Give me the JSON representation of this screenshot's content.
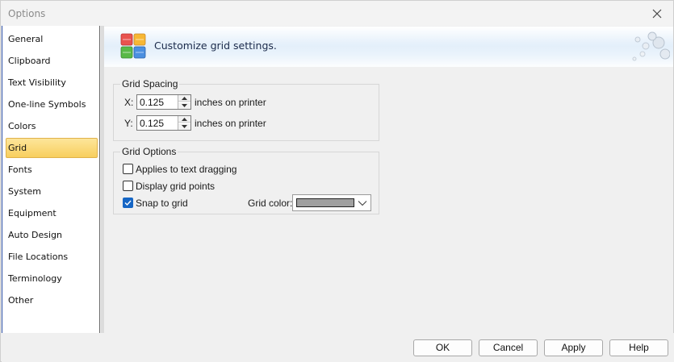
{
  "window": {
    "title": "Options"
  },
  "sidebar": {
    "items": [
      {
        "label": "General"
      },
      {
        "label": "Clipboard"
      },
      {
        "label": "Text Visibility"
      },
      {
        "label": "One-line Symbols"
      },
      {
        "label": "Colors"
      },
      {
        "label": "Grid",
        "selected": true
      },
      {
        "label": "Fonts"
      },
      {
        "label": "System"
      },
      {
        "label": "Equipment"
      },
      {
        "label": "Auto Design"
      },
      {
        "label": "File Locations"
      },
      {
        "label": "Terminology"
      },
      {
        "label": "Other"
      }
    ]
  },
  "banner": {
    "text": "Customize grid settings.",
    "icon": "grid-settings-icon"
  },
  "grid_spacing": {
    "group_label": "Grid Spacing",
    "x": {
      "label": "X:",
      "value": "0.125",
      "unit": "inches on printer"
    },
    "y": {
      "label": "Y:",
      "value": "0.125",
      "unit": "inches on printer"
    }
  },
  "grid_options": {
    "group_label": "Grid Options",
    "applies_text_dragging": {
      "label": "Applies to text dragging",
      "checked": false
    },
    "display_grid_points": {
      "label": "Display grid points",
      "checked": false
    },
    "snap_to_grid": {
      "label": "Snap to grid",
      "checked": true
    },
    "grid_color": {
      "label": "Grid color:",
      "swatch": "#a0a0a0"
    }
  },
  "footer": {
    "ok": "OK",
    "cancel": "Cancel",
    "apply": "Apply",
    "help": "Help"
  },
  "colors": {
    "selection": "#f8cf5e",
    "checkbox_accent": "#1666c5",
    "sidebar_accent": "#2b4ea6"
  }
}
